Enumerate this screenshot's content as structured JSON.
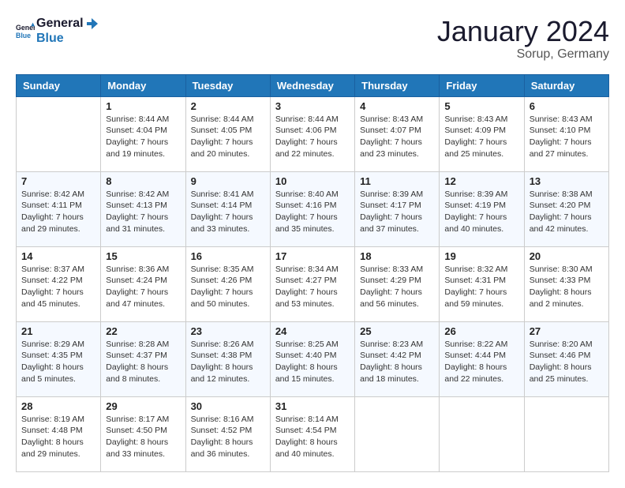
{
  "header": {
    "logo_line1": "General",
    "logo_line2": "Blue",
    "month": "January 2024",
    "location": "Sorup, Germany"
  },
  "columns": [
    "Sunday",
    "Monday",
    "Tuesday",
    "Wednesday",
    "Thursday",
    "Friday",
    "Saturday"
  ],
  "weeks": [
    [
      {
        "day": "",
        "info": ""
      },
      {
        "day": "1",
        "info": "Sunrise: 8:44 AM\nSunset: 4:04 PM\nDaylight: 7 hours\nand 19 minutes."
      },
      {
        "day": "2",
        "info": "Sunrise: 8:44 AM\nSunset: 4:05 PM\nDaylight: 7 hours\nand 20 minutes."
      },
      {
        "day": "3",
        "info": "Sunrise: 8:44 AM\nSunset: 4:06 PM\nDaylight: 7 hours\nand 22 minutes."
      },
      {
        "day": "4",
        "info": "Sunrise: 8:43 AM\nSunset: 4:07 PM\nDaylight: 7 hours\nand 23 minutes."
      },
      {
        "day": "5",
        "info": "Sunrise: 8:43 AM\nSunset: 4:09 PM\nDaylight: 7 hours\nand 25 minutes."
      },
      {
        "day": "6",
        "info": "Sunrise: 8:43 AM\nSunset: 4:10 PM\nDaylight: 7 hours\nand 27 minutes."
      }
    ],
    [
      {
        "day": "7",
        "info": "Sunrise: 8:42 AM\nSunset: 4:11 PM\nDaylight: 7 hours\nand 29 minutes."
      },
      {
        "day": "8",
        "info": "Sunrise: 8:42 AM\nSunset: 4:13 PM\nDaylight: 7 hours\nand 31 minutes."
      },
      {
        "day": "9",
        "info": "Sunrise: 8:41 AM\nSunset: 4:14 PM\nDaylight: 7 hours\nand 33 minutes."
      },
      {
        "day": "10",
        "info": "Sunrise: 8:40 AM\nSunset: 4:16 PM\nDaylight: 7 hours\nand 35 minutes."
      },
      {
        "day": "11",
        "info": "Sunrise: 8:39 AM\nSunset: 4:17 PM\nDaylight: 7 hours\nand 37 minutes."
      },
      {
        "day": "12",
        "info": "Sunrise: 8:39 AM\nSunset: 4:19 PM\nDaylight: 7 hours\nand 40 minutes."
      },
      {
        "day": "13",
        "info": "Sunrise: 8:38 AM\nSunset: 4:20 PM\nDaylight: 7 hours\nand 42 minutes."
      }
    ],
    [
      {
        "day": "14",
        "info": "Sunrise: 8:37 AM\nSunset: 4:22 PM\nDaylight: 7 hours\nand 45 minutes."
      },
      {
        "day": "15",
        "info": "Sunrise: 8:36 AM\nSunset: 4:24 PM\nDaylight: 7 hours\nand 47 minutes."
      },
      {
        "day": "16",
        "info": "Sunrise: 8:35 AM\nSunset: 4:26 PM\nDaylight: 7 hours\nand 50 minutes."
      },
      {
        "day": "17",
        "info": "Sunrise: 8:34 AM\nSunset: 4:27 PM\nDaylight: 7 hours\nand 53 minutes."
      },
      {
        "day": "18",
        "info": "Sunrise: 8:33 AM\nSunset: 4:29 PM\nDaylight: 7 hours\nand 56 minutes."
      },
      {
        "day": "19",
        "info": "Sunrise: 8:32 AM\nSunset: 4:31 PM\nDaylight: 7 hours\nand 59 minutes."
      },
      {
        "day": "20",
        "info": "Sunrise: 8:30 AM\nSunset: 4:33 PM\nDaylight: 8 hours\nand 2 minutes."
      }
    ],
    [
      {
        "day": "21",
        "info": "Sunrise: 8:29 AM\nSunset: 4:35 PM\nDaylight: 8 hours\nand 5 minutes."
      },
      {
        "day": "22",
        "info": "Sunrise: 8:28 AM\nSunset: 4:37 PM\nDaylight: 8 hours\nand 8 minutes."
      },
      {
        "day": "23",
        "info": "Sunrise: 8:26 AM\nSunset: 4:38 PM\nDaylight: 8 hours\nand 12 minutes."
      },
      {
        "day": "24",
        "info": "Sunrise: 8:25 AM\nSunset: 4:40 PM\nDaylight: 8 hours\nand 15 minutes."
      },
      {
        "day": "25",
        "info": "Sunrise: 8:23 AM\nSunset: 4:42 PM\nDaylight: 8 hours\nand 18 minutes."
      },
      {
        "day": "26",
        "info": "Sunrise: 8:22 AM\nSunset: 4:44 PM\nDaylight: 8 hours\nand 22 minutes."
      },
      {
        "day": "27",
        "info": "Sunrise: 8:20 AM\nSunset: 4:46 PM\nDaylight: 8 hours\nand 25 minutes."
      }
    ],
    [
      {
        "day": "28",
        "info": "Sunrise: 8:19 AM\nSunset: 4:48 PM\nDaylight: 8 hours\nand 29 minutes."
      },
      {
        "day": "29",
        "info": "Sunrise: 8:17 AM\nSunset: 4:50 PM\nDaylight: 8 hours\nand 33 minutes."
      },
      {
        "day": "30",
        "info": "Sunrise: 8:16 AM\nSunset: 4:52 PM\nDaylight: 8 hours\nand 36 minutes."
      },
      {
        "day": "31",
        "info": "Sunrise: 8:14 AM\nSunset: 4:54 PM\nDaylight: 8 hours\nand 40 minutes."
      },
      {
        "day": "",
        "info": ""
      },
      {
        "day": "",
        "info": ""
      },
      {
        "day": "",
        "info": ""
      }
    ]
  ]
}
